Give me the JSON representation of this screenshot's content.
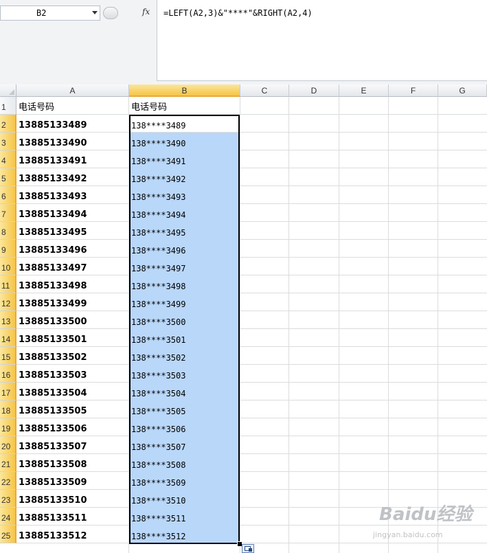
{
  "name_box": "B2",
  "fx_label": "fx",
  "formula": "=LEFT(A2,3)&\"****\"&RIGHT(A2,4)",
  "columns": [
    "A",
    "B",
    "C",
    "D",
    "E",
    "F",
    "G"
  ],
  "active_column": "B",
  "rows": [
    "1",
    "2",
    "3",
    "4",
    "5",
    "6",
    "7",
    "8",
    "9",
    "10",
    "11",
    "12",
    "13",
    "14",
    "15",
    "16",
    "17",
    "18",
    "19",
    "20",
    "21",
    "22",
    "23",
    "24",
    "25"
  ],
  "header_row": {
    "a": "电话号码",
    "b": "电话号码"
  },
  "data_rows": [
    {
      "a": "13885133489",
      "b": "138****3489"
    },
    {
      "a": "13885133490",
      "b": "138****3490"
    },
    {
      "a": "13885133491",
      "b": "138****3491"
    },
    {
      "a": "13885133492",
      "b": "138****3492"
    },
    {
      "a": "13885133493",
      "b": "138****3493"
    },
    {
      "a": "13885133494",
      "b": "138****3494"
    },
    {
      "a": "13885133495",
      "b": "138****3495"
    },
    {
      "a": "13885133496",
      "b": "138****3496"
    },
    {
      "a": "13885133497",
      "b": "138****3497"
    },
    {
      "a": "13885133498",
      "b": "138****3498"
    },
    {
      "a": "13885133499",
      "b": "138****3499"
    },
    {
      "a": "13885133500",
      "b": "138****3500"
    },
    {
      "a": "13885133501",
      "b": "138****3501"
    },
    {
      "a": "13885133502",
      "b": "138****3502"
    },
    {
      "a": "13885133503",
      "b": "138****3503"
    },
    {
      "a": "13885133504",
      "b": "138****3504"
    },
    {
      "a": "13885133505",
      "b": "138****3505"
    },
    {
      "a": "13885133506",
      "b": "138****3506"
    },
    {
      "a": "13885133507",
      "b": "138****3507"
    },
    {
      "a": "13885133508",
      "b": "138****3508"
    },
    {
      "a": "13885133509",
      "b": "138****3509"
    },
    {
      "a": "13885133510",
      "b": "138****3510"
    },
    {
      "a": "13885133511",
      "b": "138****3511"
    },
    {
      "a": "13885133512",
      "b": "138****3512"
    }
  ],
  "selection_color": "#b9d7f9",
  "watermark": {
    "brand": "Baidu经验",
    "sub": "jingyan.baidu.com"
  }
}
